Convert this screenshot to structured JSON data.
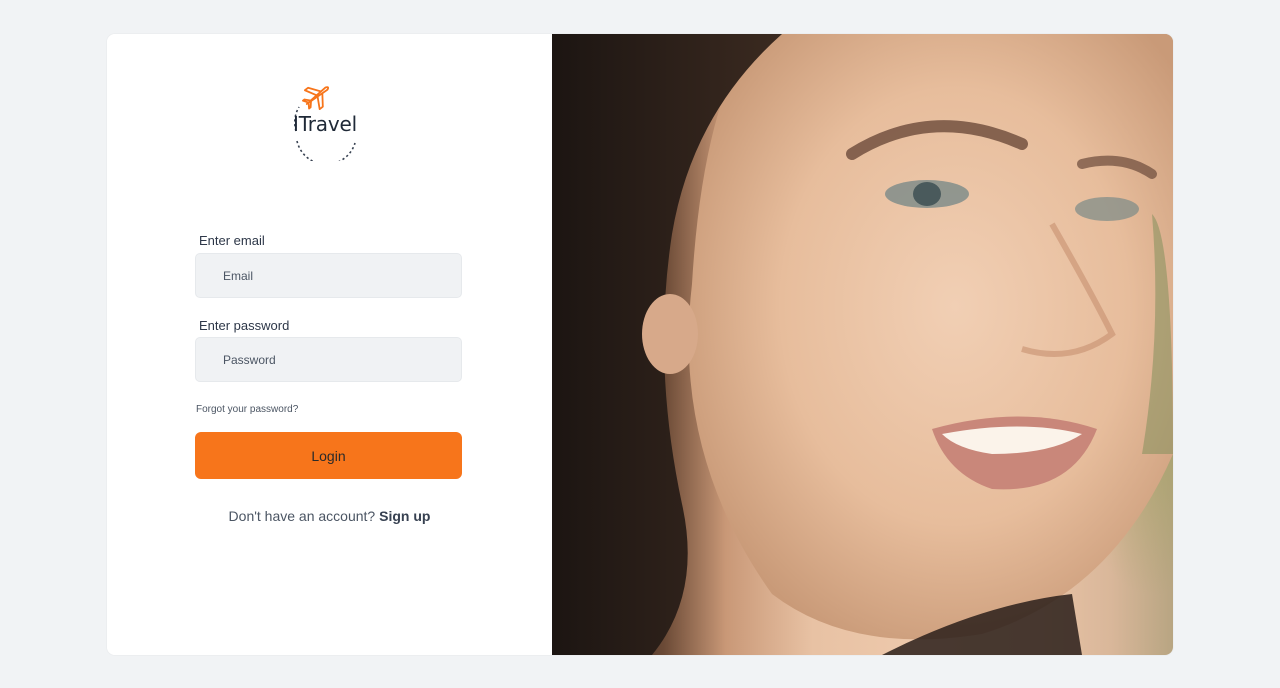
{
  "brand": {
    "name": "ITravel",
    "accent": "#f7751b"
  },
  "form": {
    "email_label": "Enter email",
    "email_placeholder": "Email",
    "password_label": "Enter password",
    "password_placeholder": "Password",
    "forgot_link": "Forgot your password?",
    "login_label": "Login"
  },
  "signup": {
    "prompt": "Don't have an account?",
    "link_label": "Sign up"
  },
  "hero_image": {
    "subject": "close-up of smiling woman"
  }
}
